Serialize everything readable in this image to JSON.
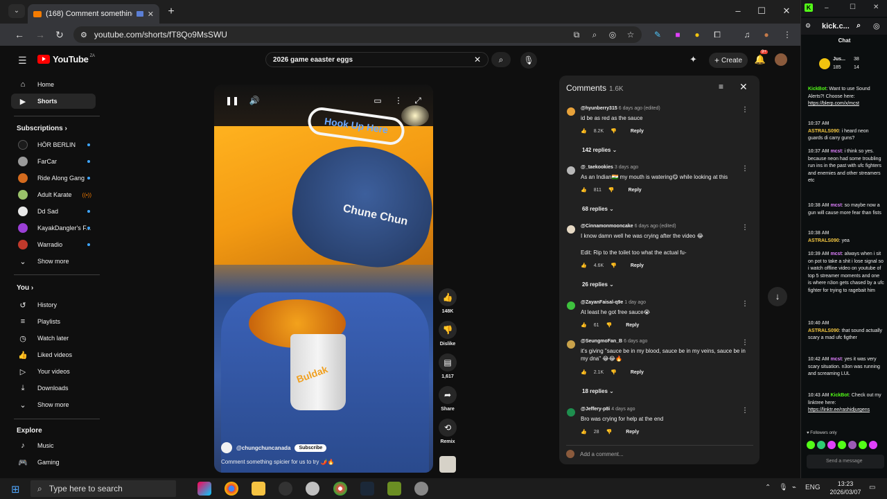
{
  "browser": {
    "tab_title": "(168) Comment something",
    "url": "youtube.com/shorts/fT8Qo9MsSWU"
  },
  "yt": {
    "logo": "YouTube",
    "logo_country": "ZA",
    "search_query": "2026 game eaaster eggs",
    "create_label": "Create",
    "notif_count": "9+"
  },
  "sidebar": {
    "home": "Home",
    "shorts": "Shorts",
    "subscriptions_heading": "Subscriptions",
    "subs": [
      {
        "name": "HÖR BERLIN",
        "color": "#1b1b1b",
        "status": "dot"
      },
      {
        "name": "FarCar",
        "color": "#9a9a9a",
        "status": "dot"
      },
      {
        "name": "Ride Along Gang",
        "color": "#d46b1e",
        "status": "dot"
      },
      {
        "name": "Adult Karate",
        "color": "#9ac26a",
        "status": "live"
      },
      {
        "name": "Dd Sad",
        "color": "#e8e8e8",
        "status": "dot"
      },
      {
        "name": "KayakDangler's F...",
        "color": "#9b3fd6",
        "status": "dot"
      },
      {
        "name": "Warradio",
        "color": "#c0392b",
        "status": "dot"
      }
    ],
    "show_more": "Show more",
    "you_heading": "You",
    "you_items": [
      "History",
      "Playlists",
      "Watch later",
      "Liked videos",
      "Your videos",
      "Downloads",
      "Show more"
    ],
    "explore_heading": "Explore",
    "explore_items": [
      "Music",
      "Gaming"
    ]
  },
  "video": {
    "sign_text": "Hook Up Here",
    "cap_logo": "Chune Chun",
    "cup_label": "Buldak",
    "channel": "@chungchuncanada",
    "subscribe": "Subscribe",
    "caption": "Comment something spicier for us to try 🌶️🔥"
  },
  "actions": {
    "likes": "148K",
    "dislike": "Dislike",
    "comments": "1,617",
    "share": "Share",
    "remix": "Remix"
  },
  "comments": {
    "title": "Comments",
    "count": "1.6K",
    "add_placeholder": "Add a comment...",
    "reply_label": "Reply",
    "items": [
      {
        "handle": "@hyunberry315",
        "ago": "6 days ago (edited)",
        "text": "id be as red as the sauce",
        "likes": "8.2K",
        "replies": "142 replies",
        "color": "#e8a23a"
      },
      {
        "handle": "@_taekookies",
        "ago": "3 days ago",
        "text": "As an Indian🇮🇳 my mouth is watering😋 while looking at this",
        "likes": "811",
        "replies": "68 replies",
        "color": "#b8b8b8"
      },
      {
        "handle": "@Cinnamonmooncake",
        "ago": "6 days ago (edited)",
        "text": "I know damn well he was crying after the video 😂",
        "text2": "Edit: Rip to the toilet too what the actual fu-",
        "likes": "4.6K",
        "replies": "26 replies",
        "color": "#e6d9c4"
      },
      {
        "handle": "@ZayanFaisal-q9e",
        "ago": "1 day ago",
        "text": "At least he got free sauce😭",
        "likes": "61",
        "color": "#3ec23e"
      },
      {
        "handle": "@SeungmoFan_B",
        "ago": "6 days ago",
        "text": "it's giving \"sauce be in my blood, sauce be in my veins, sauce be in my dna\" 😂😂🔥",
        "likes": "2.1K",
        "replies": "18 replies",
        "color": "#c9a24a"
      },
      {
        "handle": "@Jeffery-p8i",
        "ago": "4 days ago",
        "text": "Bro was crying for help at the end",
        "likes": "28",
        "color": "#1e8e4e"
      }
    ]
  },
  "kick": {
    "tab_label": "kick.c...",
    "chat_title": "Chat",
    "pinned_user": "Jus...",
    "pinned_stats": "185",
    "pinned_stats2": "38",
    "pinned_stats3": "14",
    "messages": [
      {
        "time": "",
        "user": "KickBot",
        "text": "Want to use Sound Alerts?! Choose here:",
        "link": "https://blerp.com/x/mcst"
      },
      {
        "time": "10:37 AM",
        "user": "ASTRALS090",
        "text": "i heard neon guards di carry guns?"
      },
      {
        "time": "10:37 AM",
        "user": "mcst",
        "text": "i think so yes. because neon had some troubling run ins in the past with ufc fighters and enemies and other streamers etc"
      },
      {
        "time": "10:38 AM",
        "user": "mcst",
        "text": "so maybe now a gun will cause more fear than fists"
      },
      {
        "time": "10:38 AM",
        "user": "ASTRALS090",
        "text": "yea"
      },
      {
        "time": "10:39 AM",
        "user": "mcst",
        "text": "always when i sit on pot to take a shit i lose signal so i watch offline video on youtube of top 5 streamer moments and one is where n3on gets chased by a ufc fighter for trying to ragebait him"
      },
      {
        "time": "10:40 AM",
        "user": "ASTRALS090",
        "text": "that sound actually scary a mad ufc figther"
      },
      {
        "time": "10:42 AM",
        "user": "mcst",
        "text": "yes it was very scary situation. n3on was running and screaming LUL"
      },
      {
        "time": "10:43 AM",
        "user": "KickBot",
        "text": "Check out my linktree here:",
        "link": "https://linktr.ee/rashidjurgens"
      }
    ],
    "followers_only": "Followers only",
    "send_placeholder": "Send a message"
  },
  "taskbar": {
    "search_placeholder": "Type here to search",
    "lang": "ENG",
    "time": "13:23",
    "date": "2026/03/07"
  }
}
